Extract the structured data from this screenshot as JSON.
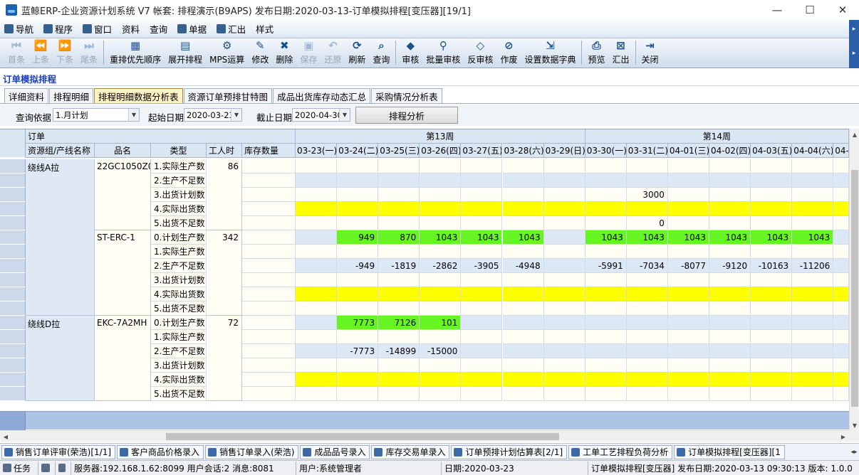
{
  "window": {
    "title": "蓝鲸ERP-企业资源计划系统 V7 帐套: 排程演示(B9APS) 发布日期:2020-03-13-订单模拟排程[变压器][19/1]",
    "minimize": "—",
    "maximize": "☐",
    "close": "✕"
  },
  "menubar": {
    "items": [
      {
        "label": "导航",
        "icon": "navigation-icon"
      },
      {
        "label": "程序",
        "icon": "program-icon"
      },
      {
        "label": "窗口",
        "icon": "window-icon"
      },
      {
        "label": "资料",
        "icon": ""
      },
      {
        "label": "查询",
        "icon": ""
      },
      {
        "label": "单据",
        "icon": "document-icon"
      },
      {
        "label": "汇出",
        "icon": "export-icon"
      },
      {
        "label": "样式",
        "icon": ""
      }
    ]
  },
  "toolbar": {
    "buttons": [
      {
        "label": "首条",
        "glyph": "⏮",
        "disabled": true,
        "name": "first-record"
      },
      {
        "label": "上条",
        "glyph": "⏪",
        "disabled": true,
        "name": "prev-record"
      },
      {
        "label": "下条",
        "glyph": "⏩",
        "disabled": true,
        "name": "next-record"
      },
      {
        "label": "尾条",
        "glyph": "⏭",
        "disabled": true,
        "name": "last-record"
      },
      {
        "sep": true
      },
      {
        "label": "重排优先顺序",
        "glyph": "▦",
        "disabled": false,
        "name": "reorder-priority"
      },
      {
        "label": "展开排程",
        "glyph": "▤",
        "disabled": false,
        "name": "expand-schedule"
      },
      {
        "label": "MPS运算",
        "glyph": "⚙",
        "disabled": false,
        "name": "mps-calc"
      },
      {
        "label": "修改",
        "glyph": "✎",
        "disabled": false,
        "name": "edit"
      },
      {
        "label": "删除",
        "glyph": "✖",
        "disabled": false,
        "name": "delete"
      },
      {
        "label": "保存",
        "glyph": "▣",
        "disabled": true,
        "name": "save"
      },
      {
        "label": "还原",
        "glyph": "↶",
        "disabled": true,
        "name": "restore"
      },
      {
        "label": "刷新",
        "glyph": "⟳",
        "disabled": false,
        "name": "refresh"
      },
      {
        "label": "查询",
        "glyph": "⌕",
        "disabled": false,
        "name": "query"
      },
      {
        "sep": true
      },
      {
        "label": "审核",
        "glyph": "◆",
        "disabled": false,
        "name": "approve"
      },
      {
        "label": "批量审核",
        "glyph": "⚲",
        "disabled": false,
        "name": "batch-approve"
      },
      {
        "label": "反审核",
        "glyph": "◇",
        "disabled": false,
        "name": "unapprove"
      },
      {
        "label": "作废",
        "glyph": "⊘",
        "disabled": false,
        "name": "void"
      },
      {
        "label": "设置数据字典",
        "glyph": "⇲",
        "disabled": false,
        "name": "data-dictionary"
      },
      {
        "sep": true
      },
      {
        "label": "预览",
        "glyph": "⎙",
        "disabled": false,
        "name": "preview"
      },
      {
        "label": "汇出",
        "glyph": "⊠",
        "disabled": false,
        "name": "export"
      },
      {
        "sep": true
      },
      {
        "label": "关闭",
        "glyph": "⇥",
        "disabled": false,
        "name": "close"
      }
    ]
  },
  "page_title": "订单模拟排程",
  "tabs": [
    {
      "label": "详细资料",
      "active": false
    },
    {
      "label": "排程明细",
      "active": false
    },
    {
      "label": "排程明细数据分析表",
      "active": true
    },
    {
      "label": "资源订单预排甘特图",
      "active": false
    },
    {
      "label": "成品出货库存动态汇总",
      "active": false
    },
    {
      "label": "采购情况分析表",
      "active": false
    }
  ],
  "filter": {
    "basis_label": "查询依据",
    "basis_value": "1.月计划",
    "start_label": "起始日期",
    "start_value": "2020-03-23",
    "end_label": "截止日期",
    "end_value": "2020-04-30",
    "analyze_button": "排程分析"
  },
  "grid": {
    "group_order": "订单",
    "week13": "第13周",
    "week14": "第14周",
    "col_resource": "资源组/产线名称",
    "col_product": "品名",
    "col_type": "类型",
    "col_hours": "工人时",
    "col_stock": "库存数量",
    "dates": [
      "03-23(一)",
      "03-24(二)",
      "03-25(三)",
      "03-26(四)",
      "03-27(五)",
      "03-28(六)",
      "03-29(日)",
      "03-30(一)",
      "03-31(二)",
      "04-01(三)",
      "04-02(四)",
      "04-03(五)",
      "04-04(六)",
      "04-0"
    ],
    "groups": [
      {
        "resource": "绕线A拉",
        "products": [
          {
            "name": "22GC1050Z0",
            "hours": "86",
            "rows": [
              {
                "type": "1.实际生产数",
                "style": "white",
                "values": [
                  "",
                  "",
                  "",
                  "",
                  "",
                  "",
                  "",
                  "",
                  "",
                  "",
                  "",
                  "",
                  "",
                  ""
                ]
              },
              {
                "type": "2.生产不足数",
                "style": "blue",
                "values": [
                  "",
                  "",
                  "",
                  "",
                  "",
                  "",
                  "",
                  "",
                  "",
                  "",
                  "",
                  "",
                  "",
                  ""
                ]
              },
              {
                "type": "3.出货计划数",
                "style": "white",
                "values": [
                  "",
                  "",
                  "",
                  "",
                  "",
                  "",
                  "",
                  "",
                  "3000",
                  "",
                  "",
                  "",
                  "",
                  ""
                ]
              },
              {
                "type": "4.实际出货数",
                "style": "yellow",
                "values": [
                  "",
                  "",
                  "",
                  "",
                  "",
                  "",
                  "",
                  "",
                  "",
                  "",
                  "",
                  "",
                  "",
                  ""
                ]
              },
              {
                "type": "5.出货不足数",
                "style": "white",
                "values": [
                  "",
                  "",
                  "",
                  "",
                  "",
                  "",
                  "",
                  "",
                  "0",
                  "",
                  "",
                  "",
                  "",
                  ""
                ]
              }
            ]
          },
          {
            "name": "ST-ERC-1",
            "hours": "342",
            "rows": [
              {
                "type": "0.计划生产数",
                "style": "green",
                "values": [
                  "",
                  "949",
                  "870",
                  "1043",
                  "1043",
                  "1043",
                  "",
                  "1043",
                  "1043",
                  "1043",
                  "1043",
                  "1043",
                  "1043",
                  ""
                ]
              },
              {
                "type": "1.实际生产数",
                "style": "white",
                "values": [
                  "",
                  "",
                  "",
                  "",
                  "",
                  "",
                  "",
                  "",
                  "",
                  "",
                  "",
                  "",
                  "",
                  ""
                ]
              },
              {
                "type": "2.生产不足数",
                "style": "blue",
                "values": [
                  "",
                  "-949",
                  "-1819",
                  "-2862",
                  "-3905",
                  "-4948",
                  "",
                  "-5991",
                  "-7034",
                  "-8077",
                  "-9120",
                  "-10163",
                  "-11206",
                  ""
                ]
              },
              {
                "type": "3.出货计划数",
                "style": "white",
                "values": [
                  "",
                  "",
                  "",
                  "",
                  "",
                  "",
                  "",
                  "",
                  "",
                  "",
                  "",
                  "",
                  "",
                  ""
                ]
              },
              {
                "type": "4.实际出货数",
                "style": "yellow",
                "values": [
                  "",
                  "",
                  "",
                  "",
                  "",
                  "",
                  "",
                  "",
                  "",
                  "",
                  "",
                  "",
                  "",
                  ""
                ]
              },
              {
                "type": "5.出货不足数",
                "style": "white",
                "values": [
                  "",
                  "",
                  "",
                  "",
                  "",
                  "",
                  "",
                  "",
                  "",
                  "",
                  "",
                  "",
                  "",
                  ""
                ]
              }
            ]
          }
        ]
      },
      {
        "resource": "绕线D拉",
        "products": [
          {
            "name": "EKC-7A2MH",
            "hours": "72",
            "rows": [
              {
                "type": "0.计划生产数",
                "style": "green",
                "values": [
                  "",
                  "7773",
                  "7126",
                  "101",
                  "",
                  "",
                  "",
                  "",
                  "",
                  "",
                  "",
                  "",
                  "",
                  ""
                ]
              },
              {
                "type": "1.实际生产数",
                "style": "white",
                "values": [
                  "",
                  "",
                  "",
                  "",
                  "",
                  "",
                  "",
                  "",
                  "",
                  "",
                  "",
                  "",
                  "",
                  ""
                ]
              },
              {
                "type": "2.生产不足数",
                "style": "blue",
                "values": [
                  "",
                  "-7773",
                  "-14899",
                  "-15000",
                  "",
                  "",
                  "",
                  "",
                  "",
                  "",
                  "",
                  "",
                  "",
                  ""
                ]
              },
              {
                "type": "3.出货计划数",
                "style": "white",
                "values": [
                  "",
                  "",
                  "",
                  "",
                  "",
                  "",
                  "",
                  "",
                  "",
                  "",
                  "",
                  "",
                  "",
                  ""
                ]
              },
              {
                "type": "4.实际出货数",
                "style": "yellow",
                "values": [
                  "",
                  "",
                  "",
                  "",
                  "",
                  "",
                  "",
                  "",
                  "",
                  "",
                  "",
                  "",
                  "",
                  ""
                ]
              },
              {
                "type": "5.出货不足数",
                "style": "white",
                "values": [
                  "",
                  "",
                  "",
                  "",
                  "",
                  "",
                  "",
                  "",
                  "",
                  "",
                  "",
                  "",
                  "",
                  ""
                ]
              }
            ]
          }
        ]
      }
    ],
    "colors": {
      "green": "#66f522",
      "yellow": "#ffff00",
      "blue": "#dde8f7",
      "white": "#fffdf4"
    }
  },
  "window_tabs": [
    "销售订单评审(荣浩)[1/1]",
    "客户商品价格录入",
    "销售订单录入(荣浩)",
    "成品品号录入",
    "库存交易单录入",
    "订单预排计划估算表[2/1]",
    "工单工艺排程负荷分析",
    "订单模拟排程[变压器][1"
  ],
  "status": {
    "task": "任务",
    "server": "服务器:192.168.1.62:8099 用户会话:2 消息:8081",
    "user": "用户:系统管理者",
    "date": "日期:2020-03-23",
    "release": "订单模拟排程[变压器] 发布日期:2020-03-13 09:30:13 版本: 1.0.0"
  }
}
